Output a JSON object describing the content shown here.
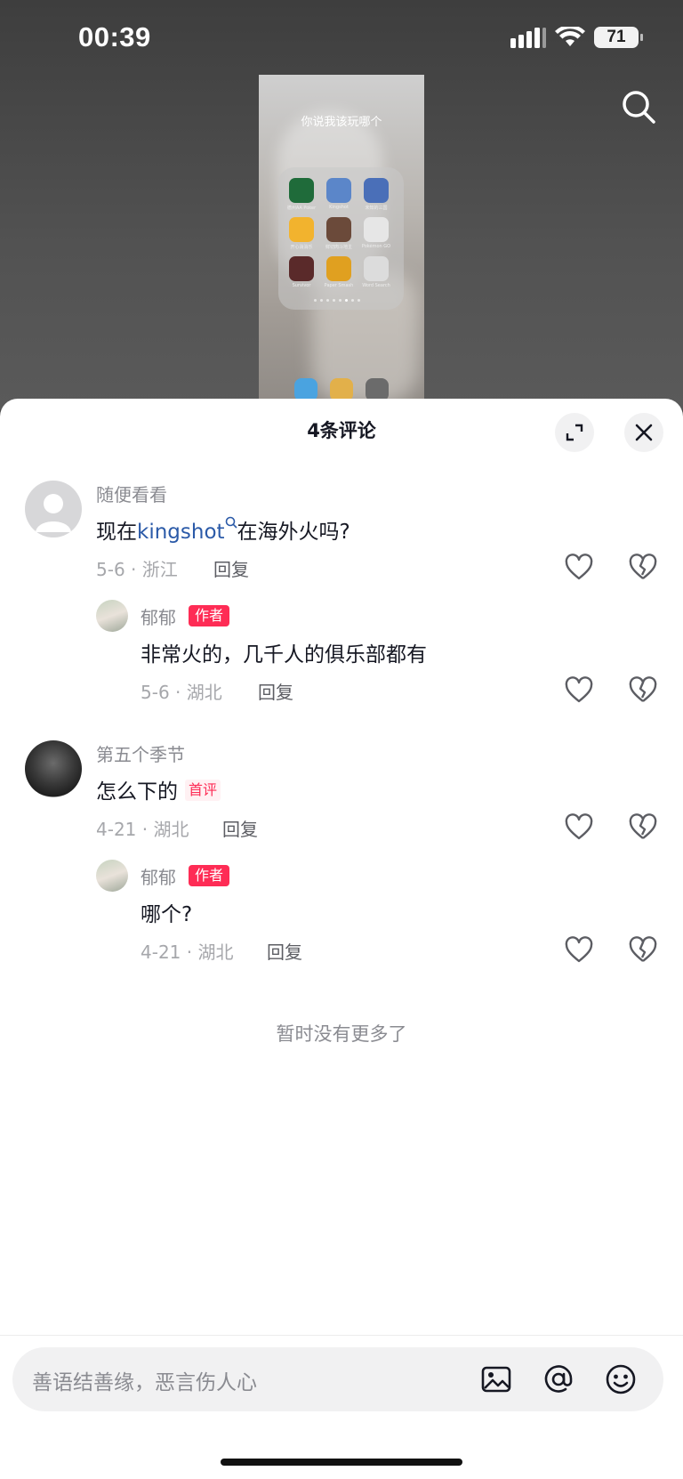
{
  "status_bar": {
    "time": "00:39",
    "battery": "71"
  },
  "video": {
    "caption": "你说我该玩哪个",
    "apps": [
      {
        "label": "德州AA Poker",
        "color": "#1f6b3a"
      },
      {
        "label": "Kingshot",
        "color": "#5b86c9"
      },
      {
        "label": "未知的三国",
        "color": "#4a6fb8"
      },
      {
        "label": "开心消消乐",
        "color": "#f2b32e"
      },
      {
        "label": "鲜切肉斗地主",
        "color": "#6b4a3a"
      },
      {
        "label": "Pokémon GO",
        "color": "#e6e6e6"
      },
      {
        "label": "Survivor",
        "color": "#5a2a2a"
      },
      {
        "label": "Paper Smash",
        "color": "#e0a020"
      },
      {
        "label": "Word Search",
        "color": "#dcdcdc"
      }
    ]
  },
  "sheet": {
    "title": "4条评论",
    "comments": [
      {
        "user": "随便看看",
        "text_prefix": "现在",
        "text_keyword": "kingshot",
        "text_suffix": "在海外火吗?",
        "meta": "5-6 · 浙江",
        "reply": "回复",
        "replies": [
          {
            "user": "郁郁",
            "badge": "作者",
            "text": "非常火的，几千人的俱乐部都有",
            "meta": "5-6 · 湖北",
            "reply": "回复"
          }
        ]
      },
      {
        "user": "第五个季节",
        "text": "怎么下的",
        "first_badge": "首评",
        "meta": "4-21 · 湖北",
        "reply": "回复",
        "replies": [
          {
            "user": "郁郁",
            "badge": "作者",
            "text": "哪个?",
            "meta": "4-21 · 湖北",
            "reply": "回复"
          }
        ]
      }
    ],
    "no_more": "暂时没有更多了"
  },
  "input": {
    "placeholder": "善语结善缘，恶言伤人心"
  },
  "colors": {
    "accent": "#fe2c55",
    "keyword": "#2b5aa8"
  }
}
